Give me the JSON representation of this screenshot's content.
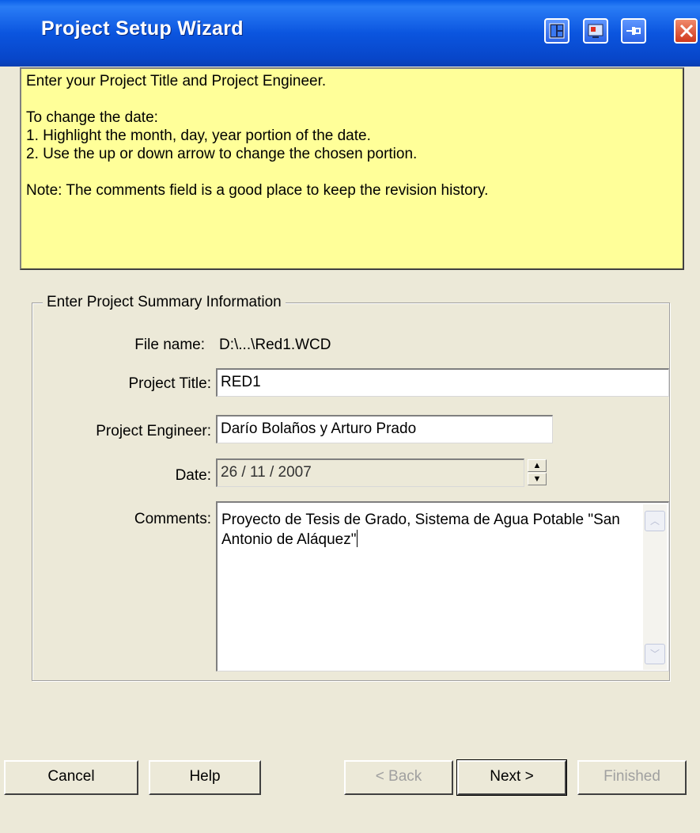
{
  "window": {
    "title": "Project Setup Wizard",
    "title_buttons": [
      "layout-icon",
      "monitor-icon",
      "pin-icon",
      "close-icon"
    ]
  },
  "help": {
    "line1": "Enter your Project Title and Project Engineer.",
    "line2": "To change the date:",
    "line3": "1. Highlight the month, day, year portion of the date.",
    "line4": "2. Use the up or down arrow to change the chosen portion.",
    "line5": "Note: The comments field is a good place to keep the revision history."
  },
  "form": {
    "group_title": "Enter Project Summary Information",
    "file_name_label": "File name:",
    "file_name_value": "D:\\...\\Red1.WCD",
    "project_title_label": "Project Title:",
    "project_title_value": "RED1",
    "engineer_label": "Project Engineer:",
    "engineer_value": "Darío Bolaños y Arturo Prado",
    "date_label": "Date:",
    "date_value": "26 / 11 / 2007",
    "comments_label": "Comments:",
    "comments_value": "Proyecto de Tesis de Grado, Sistema de Agua Potable \"San Antonio de Aláquez\""
  },
  "buttons": {
    "cancel": "Cancel",
    "help": "Help",
    "back": "< Back",
    "next": "Next >",
    "finished": "Finished"
  },
  "colors": {
    "title_bar": "#0b55df",
    "help_background": "#ffff99",
    "dialog_background": "#ece9d8"
  }
}
